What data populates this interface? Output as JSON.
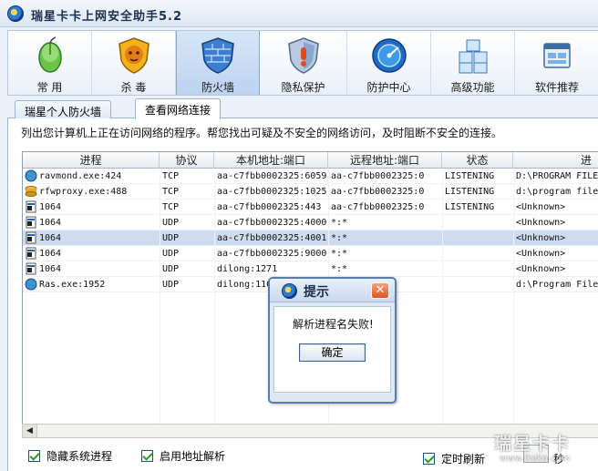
{
  "window": {
    "title": "瑞星卡卡上网安全助手5.2"
  },
  "toolbar": {
    "items": [
      {
        "label": "常 用",
        "icon": "mouse-icon"
      },
      {
        "label": "杀 毒",
        "icon": "lion-shield-icon"
      },
      {
        "label": "防火墙",
        "icon": "firewall-icon"
      },
      {
        "label": "隐私保护",
        "icon": "privacy-shield-icon"
      },
      {
        "label": "防护中心",
        "icon": "protection-center-icon"
      },
      {
        "label": "高级功能",
        "icon": "blocks-icon"
      },
      {
        "label": "软件推荐",
        "icon": "software-window-icon"
      }
    ],
    "active_index": 2
  },
  "tabs": [
    {
      "label": "瑞星个人防火墙"
    },
    {
      "label": "查看网络连接"
    }
  ],
  "description": "列出您计算机上正在访问网络的程序。帮您找出可疑及不安全的网络访问，及时阻断不安全的连接。",
  "table": {
    "columns": [
      "进程",
      "协议",
      "本机地址:端口",
      "远程地址:端口",
      "状态",
      "进"
    ],
    "rows": [
      {
        "process": "ravmond.exe:424",
        "protocol": "TCP",
        "local": "aa-c7fbb0002325:6059",
        "remote": "aa-c7fbb0002325:0",
        "state": "LISTENING",
        "path": "D:\\PROGRAM FILE",
        "icon": "globe-icon"
      },
      {
        "process": "rfwproxy.exe:488",
        "protocol": "TCP",
        "local": "aa-c7fbb0002325:1025",
        "remote": "aa-c7fbb0002325:0",
        "state": "LISTENING",
        "path": "d:\\program file",
        "icon": "proxy-icon"
      },
      {
        "process": "1064",
        "protocol": "TCP",
        "local": "aa-c7fbb0002325:443",
        "remote": "aa-c7fbb0002325:0",
        "state": "LISTENING",
        "path": "<Unknown>",
        "icon": "process-icon"
      },
      {
        "process": "1064",
        "protocol": "UDP",
        "local": "aa-c7fbb0002325:4000",
        "remote": "*:*",
        "state": "",
        "path": "<Unknown>",
        "icon": "process-icon"
      },
      {
        "process": "1064",
        "protocol": "UDP",
        "local": "aa-c7fbb0002325:4001",
        "remote": "*:*",
        "state": "",
        "path": "<Unknown>",
        "icon": "process-icon"
      },
      {
        "process": "1064",
        "protocol": "UDP",
        "local": "aa-c7fbb0002325:9000",
        "remote": "*:*",
        "state": "",
        "path": "<Unknown>",
        "icon": "process-icon"
      },
      {
        "process": "1064",
        "protocol": "UDP",
        "local": "dilong:1271",
        "remote": "*:*",
        "state": "",
        "path": "<Unknown>",
        "icon": "process-icon"
      },
      {
        "process": "Ras.exe:1952",
        "protocol": "UDP",
        "local": "dilong:110",
        "remote": "",
        "state": "",
        "path": "d:\\Program File",
        "icon": "globe-icon"
      }
    ],
    "selected_row": 4
  },
  "options": {
    "hide_system": "隐藏系统进程",
    "resolve_address": "启用地址解析",
    "auto_refresh": "定时刷新",
    "refresh_tail": "秒"
  },
  "dialog": {
    "title": "提示",
    "message": "解析进程名失败!",
    "ok_label": "确定"
  },
  "watermark": {
    "brand": "瑞星卡卡",
    "url": "www.ikaka.com"
  }
}
